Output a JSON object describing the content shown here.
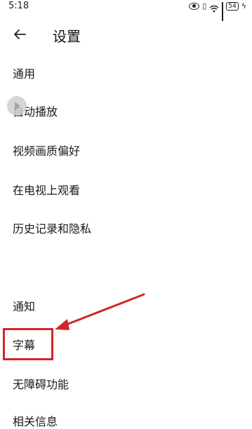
{
  "status_bar": {
    "time": "5:18",
    "battery": "54"
  },
  "header": {
    "title": "设置"
  },
  "menu": {
    "items": [
      {
        "label": "通用"
      },
      {
        "label": "自动播放"
      },
      {
        "label": "视频画质偏好"
      },
      {
        "label": "在电视上观看"
      },
      {
        "label": "历史记录和隐私"
      },
      {
        "label": "通知"
      },
      {
        "label": "字幕"
      },
      {
        "label": "无障碍功能"
      },
      {
        "label": "相关信息"
      }
    ]
  },
  "colors": {
    "highlight": "#d3252a",
    "text": "#1a1a1a"
  }
}
